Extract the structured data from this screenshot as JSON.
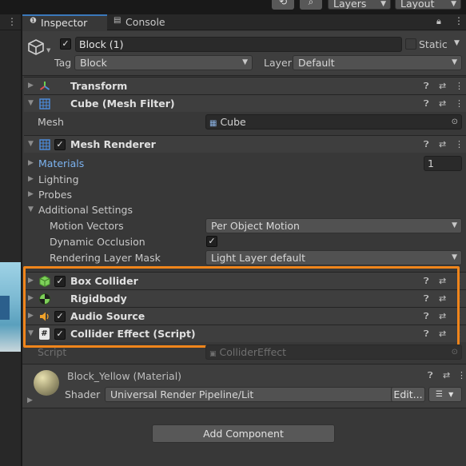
{
  "toolbar": {
    "history_icon": "history-icon",
    "search_icon": "search-icon",
    "layers_label": "Layers",
    "layout_label": "Layout"
  },
  "tabs": {
    "inspector_label": "Inspector",
    "console_label": "Console"
  },
  "gameobject": {
    "active": true,
    "name": "Block (1)",
    "static_label": "Static",
    "tag_label": "Tag",
    "tag_value": "Block",
    "layer_label": "Layer",
    "layer_value": "Default"
  },
  "transform": {
    "title": "Transform"
  },
  "mesh_filter": {
    "title": "Cube (Mesh Filter)",
    "mesh_label": "Mesh",
    "mesh_value": "Cube"
  },
  "mesh_renderer": {
    "title": "Mesh Renderer",
    "materials_label": "Materials",
    "materials_count": "1",
    "lighting_label": "Lighting",
    "probes_label": "Probes",
    "additional_label": "Additional Settings",
    "motion_vectors_label": "Motion Vectors",
    "motion_vectors_value": "Per Object Motion",
    "dynamic_occlusion_label": "Dynamic Occlusion",
    "dynamic_occlusion_checked": true,
    "rendering_layer_label": "Rendering Layer Mask",
    "rendering_layer_value": "Light Layer default"
  },
  "components": [
    {
      "title": "Box Collider",
      "icon": "box-collider-icon",
      "checked": true
    },
    {
      "title": "Rigidbody",
      "icon": "rigidbody-icon",
      "checked": false
    },
    {
      "title": "Audio Source",
      "icon": "audio-source-icon",
      "checked": true
    },
    {
      "title": "Collider Effect (Script)",
      "icon": "script-icon",
      "checked": true
    }
  ],
  "script_field": {
    "label": "Script",
    "value": "ColliderEffect"
  },
  "material": {
    "name": "Block_Yellow (Material)",
    "shader_label": "Shader",
    "shader_value": "Universal Render Pipeline/Lit",
    "edit_label": "Edit..."
  },
  "add_component_label": "Add Component",
  "colors": {
    "highlight": "#f0851b",
    "materials_link": "#7cb3f0",
    "panel": "#383838",
    "header": "#3e3e3e"
  }
}
